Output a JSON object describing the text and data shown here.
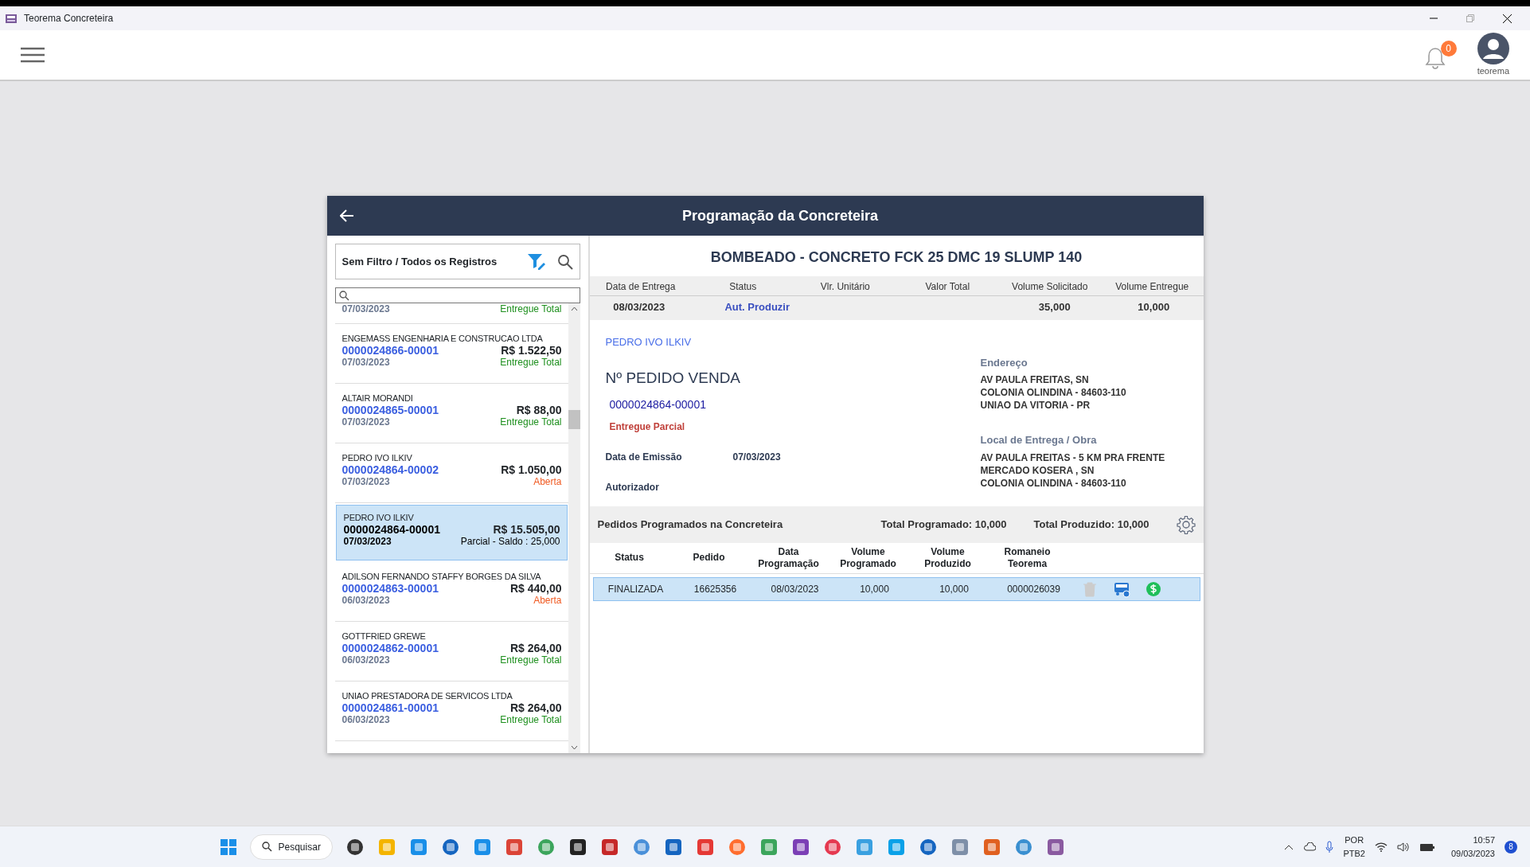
{
  "window": {
    "title": "Teorema Concreteira"
  },
  "header": {
    "notifications": "0",
    "user": "teorema"
  },
  "dialog": {
    "title": "Programação da Concreteira"
  },
  "filter": {
    "label": "Sem Filtro / Todos os Registros"
  },
  "orders": [
    {
      "kind": "partial",
      "date": "07/03/2023",
      "status": "Entregue Total",
      "color": "#1d8f1d",
      "selected": false
    },
    {
      "kind": "full",
      "client": "ENGEMASS ENGENHARIA E CONSTRUCAO LTDA",
      "number": "0000024866-00001",
      "amount": "R$ 1.522,50",
      "date": "07/03/2023",
      "status": "Entregue Total",
      "color": "#1d8f1d",
      "selected": false
    },
    {
      "kind": "full",
      "client": "ALTAIR MORANDI",
      "number": "0000024865-00001",
      "amount": "R$ 88,00",
      "date": "07/03/2023",
      "status": "Entregue Total",
      "color": "#1d8f1d",
      "selected": false
    },
    {
      "kind": "full",
      "client": "PEDRO IVO ILKIV",
      "number": "0000024864-00002",
      "amount": "R$ 1.050,00",
      "date": "07/03/2023",
      "status": "Aberta",
      "color": "#f05a22",
      "selected": false
    },
    {
      "kind": "full",
      "client": "PEDRO IVO ILKIV",
      "number": "0000024864-00001",
      "amount": "R$ 15.505,00",
      "date": "07/03/2023",
      "status": "Parcial - Saldo : 25,000",
      "color": "#000000",
      "selected": true
    },
    {
      "kind": "full",
      "client": "ADILSON FERNANDO STAFFY BORGES DA SILVA",
      "number": "0000024863-00001",
      "amount": "R$ 440,00",
      "date": "06/03/2023",
      "status": "Aberta",
      "color": "#f05a22",
      "selected": false
    },
    {
      "kind": "full",
      "client": "GOTTFRIED GREWE",
      "number": "0000024862-00001",
      "amount": "R$ 264,00",
      "date": "06/03/2023",
      "status": "Entregue Total",
      "color": "#1d8f1d",
      "selected": false
    },
    {
      "kind": "full",
      "client": "UNIAO PRESTADORA DE SERVICOS LTDA",
      "number": "0000024861-00001",
      "amount": "R$ 264,00",
      "date": "06/03/2023",
      "status": "Entregue Total",
      "color": "#1d8f1d",
      "selected": false
    }
  ],
  "detail": {
    "product": "BOMBEADO - CONCRETO FCK 25 DMC 19 SLUMP 140",
    "summary": [
      {
        "label": "Data de Entrega",
        "value": "08/03/2023",
        "kind": "plain"
      },
      {
        "label": "Status",
        "value": "Aut. Produzir",
        "kind": "status"
      },
      {
        "label": "Vlr. Unitário",
        "kind": "plain"
      },
      {
        "label": "Valor Total",
        "kind": "plain"
      },
      {
        "label": "Volume Solicitado",
        "value": "35,000",
        "kind": "plain"
      },
      {
        "label": "Volume Entregue",
        "value": "10,000",
        "kind": "plain"
      }
    ],
    "customer": "PEDRO IVO ILKIV",
    "order_title": "Nº PEDIDO VENDA",
    "order_number": "0000024864-00001",
    "order_status": "Entregue Parcial",
    "fields": [
      {
        "label": "Data de Emissão",
        "value": "07/03/2023"
      },
      {
        "label": "Autorizador"
      }
    ],
    "address": {
      "title": "Endereço",
      "lines": [
        "AV PAULA FREITAS, SN",
        "COLONIA OLINDINA - 84603-110",
        "UNIAO DA VITORIA - PR"
      ]
    },
    "delivery": {
      "title": "Local de Entrega / Obra",
      "lines": [
        "AV PAULA FREITAS - 5 KM PRA FRENTE",
        "MERCADO KOSERA , SN",
        "COLONIA OLINDINA - 84603-110"
      ]
    }
  },
  "scheduled": {
    "title": "Pedidos Programados na Concreteira",
    "total_programmed": "Total Programado: 10,000",
    "total_produced": "Total Produzido: 10,000",
    "columns": [
      "Status",
      "Pedido",
      "Data Programação",
      "Volume Programado",
      "Volume Produzido",
      "Romaneio Teorema"
    ],
    "rows": [
      {
        "cells": [
          "FINALIZADA",
          "16625356",
          "08/03/2023",
          "10,000",
          "10,000",
          "0000026039"
        ],
        "selected": true,
        "delete_disabled": true
      }
    ]
  },
  "taskbar": {
    "search": "Pesquisar",
    "language": "POR",
    "layout": "PTB2",
    "time": "10:57",
    "date": "09/03/2023",
    "notifications": "8"
  }
}
